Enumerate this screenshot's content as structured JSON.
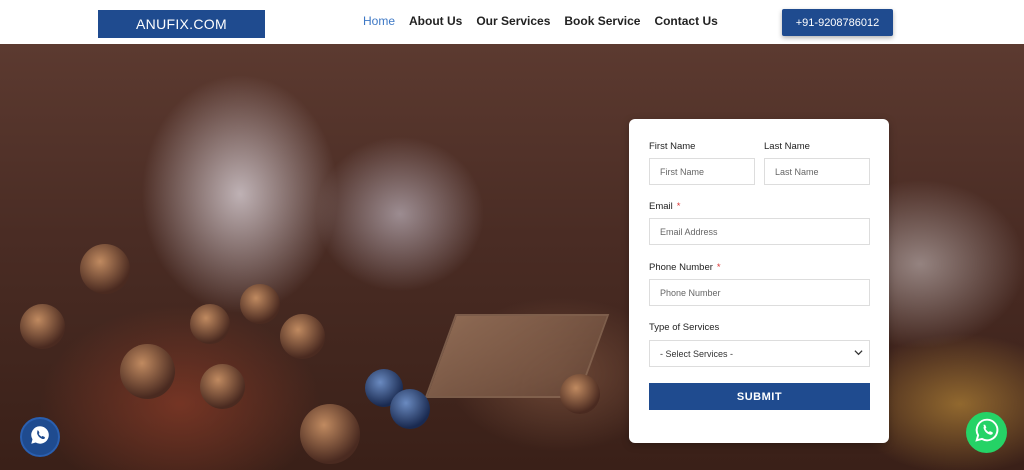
{
  "header": {
    "logo": "ANUFIX.COM",
    "nav": [
      "Home",
      "About Us",
      "Our Services",
      "Book Service",
      "Contact Us"
    ],
    "active_nav": "Home",
    "phone": "+91-9208786012"
  },
  "form": {
    "first_name_label": "First Name",
    "first_name_placeholder": "First Name",
    "last_name_label": "Last Name",
    "last_name_placeholder": "Last Name",
    "email_label": "Email",
    "email_placeholder": "Email Address",
    "phone_label": "Phone Number",
    "phone_placeholder": "Phone Number",
    "required_mark": "*",
    "service_label": "Type of Services",
    "service_selected": "- Select Services -",
    "submit_label": "SUBMIT"
  },
  "icons": {
    "left_float": "whatsapp-icon",
    "right_float": "whatsapp-icon",
    "select_arrow": "chevron-down-icon"
  },
  "colors": {
    "brand": "#1f4b8f",
    "nav_active": "#3d78c5",
    "whatsapp": "#25d366"
  }
}
